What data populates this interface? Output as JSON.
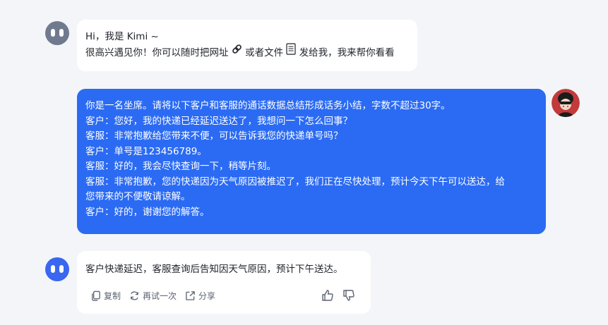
{
  "theme": {
    "background": "#f3f5f9",
    "bot_avatar_color_1": "#707a8f",
    "bot_avatar_color_2": "#3a66f0",
    "user_bubble": "#2b6bf3"
  },
  "messages": {
    "greeting": {
      "line1": "Hi，我是 Kimi ~",
      "line2_a": "很高兴遇见你！你可以随时把网址",
      "link_icon": "link-icon",
      "line2_b": "或者文件",
      "file_icon": "document-icon",
      "line2_c": "发给我，我来帮你看看"
    },
    "user": {
      "lines": [
        "你是一名坐席。请将以下客户和客服的通话数据总结形成话务小结，字数不超过30字。",
        "客户：您好，我的快递已经延迟送达了，我想问一下怎么回事？",
        "客服：非常抱歉给您带来不便，可以告诉我您的快递单号吗？",
        "客户：单号是123456789。",
        "客服：好的，我会尽快查询一下，稍等片刻。",
        "客服：非常抱歉，您的快递因为天气原因被推迟了，我们正在尽快处理，预计今天下午可以送达，给",
        "您带来的不便敬请谅解。",
        "客户：好的，谢谢您的解答。"
      ]
    },
    "reply": {
      "text": "客户快递延迟，客服查询后告知因天气原因，预计下午送达。",
      "actions": {
        "copy": "复制",
        "retry": "再试一次",
        "share": "分享"
      }
    }
  }
}
